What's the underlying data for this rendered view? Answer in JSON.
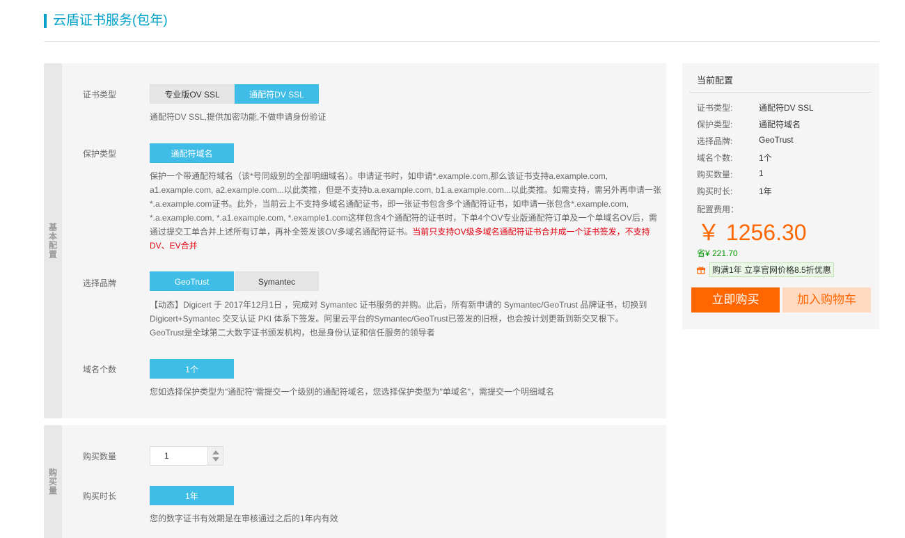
{
  "header": {
    "title": "云盾证书服务(包年)"
  },
  "basic": {
    "side_label": "基本配置",
    "cert_type": {
      "label": "证书类型",
      "options": [
        "专业版OV SSL",
        "通配符DV SSL"
      ],
      "selected": "通配符DV SSL",
      "desc": "通配符DV SSL,提供加密功能,不做申请身份验证"
    },
    "protect_type": {
      "label": "保护类型",
      "options": [
        "通配符域名"
      ],
      "selected": "通配符域名",
      "desc": "保护一个带通配符域名（该*号同级别的全部明细域名）。申请证书时，如申请*.example.com,那么该证书支持a.example.com, a1.example.com, a2.example.com...以此类推，但是不支持b.a.example.com, b1.a.example.com...以此类推。如需支持，需另外再申请一张*.a.example.com证书。此外，当前云上不支持多域名通配证书，即一张证书包含多个通配符证书，如申请一张包含*.example.com, *.a.example.com, *.a1.example.com, *.example1.com这样包含4个通配符的证书时，下单4个OV专业版通配符订单及一个单域名OV后，需通过提交工单合并上述所有订单，再补全签发该OV多域名通配符证书。",
      "warn": "当前只支持OV级多域名通配符证书合并成一个证书签发，不支持DV、EV合并"
    },
    "brand": {
      "label": "选择品牌",
      "options": [
        "GeoTrust",
        "Symantec"
      ],
      "selected": "GeoTrust",
      "desc_1": "【动态】Digicert 于 2017年12月1日 ，完成对 Symantec 证书服务的并购。此后，所有新申请的 Symantec/GeoTrust 品牌证书，切换到 Digicert+Symantec 交叉认证 PKI 体系下签发。阿里云平台的Symantec/GeoTrust已签发的旧根，也会按计划更新到新交叉根下。",
      "desc_2": "GeoTrust是全球第二大数字证书颁发机构，也是身份认证和信任服务的领导者"
    },
    "domain_count": {
      "label": "域名个数",
      "options": [
        "1个"
      ],
      "selected": "1个",
      "desc": "您如选择保护类型为\"通配符\"需提交一个级别的通配符域名，您选择保护类型为\"单域名\"，需提交一个明细域名"
    }
  },
  "buy": {
    "side_label": "购买量",
    "quantity": {
      "label": "购买数量",
      "value": "1"
    },
    "duration": {
      "label": "购买时长",
      "options": [
        "1年"
      ],
      "selected": "1年",
      "desc": "您的数字证书有效期是在审核通过之后的1年内有效"
    }
  },
  "summary": {
    "title": "当前配置",
    "items": [
      {
        "key": "证书类型:",
        "value": "通配符DV SSL"
      },
      {
        "key": "保护类型:",
        "value": "通配符域名"
      },
      {
        "key": "选择品牌:",
        "value": "GeoTrust"
      },
      {
        "key": "域名个数:",
        "value": "1个"
      },
      {
        "key": "购买数量:",
        "value": "1"
      },
      {
        "key": "购买时长:",
        "value": "1年"
      }
    ],
    "fee_label": "配置费用：",
    "price": "￥ 1256.30",
    "save": "省¥ 221.70",
    "promo": "购满1年 立享官网价格8.5折优惠",
    "buy_button": "立即购买",
    "cart_button": "加入购物车"
  },
  "colors": {
    "accent": "#3fbde6",
    "title": "#00a2ca",
    "price": "#ff6600",
    "warn": "#e4000f"
  }
}
